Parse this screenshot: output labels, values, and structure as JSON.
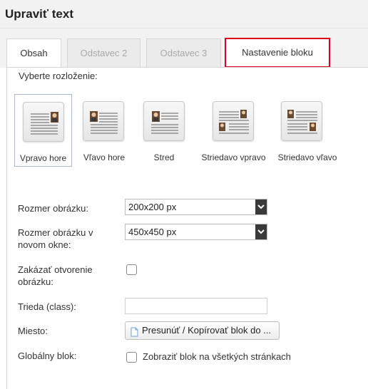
{
  "window": {
    "title": "Upraviť text"
  },
  "tabs": [
    {
      "label": "Obsah"
    },
    {
      "label": "Odstavec 2"
    },
    {
      "label": "Odstavec 3"
    },
    {
      "label": "Nastavenie bloku"
    }
  ],
  "layout": {
    "label": "Vyberte rozloženie:",
    "options": [
      {
        "label": "Vpravo hore",
        "icon": "image-right-top-icon"
      },
      {
        "label": "Vľavo hore",
        "icon": "image-left-top-icon"
      },
      {
        "label": "Stred",
        "icon": "image-center-icon"
      },
      {
        "label": "Striedavo vpravo",
        "icon": "image-alternate-right-icon"
      },
      {
        "label": "Striedavo vľavo",
        "icon": "image-alternate-left-icon"
      }
    ],
    "selected": "Vpravo hore"
  },
  "form": {
    "image_size": {
      "label": "Rozmer obrázku:",
      "value": "200x200 px"
    },
    "image_size_window": {
      "label": "Rozmer obrázku v novom okne:",
      "value": "450x450 px"
    },
    "disable_open": {
      "label": "Zakázať otvorenie obrázku:",
      "checked": false
    },
    "css_class": {
      "label": "Trieda (class):",
      "value": ""
    },
    "place": {
      "label": "Miesto:",
      "button": "Presunúť / Kopírovať blok do ..."
    },
    "global_block": {
      "label": "Globálny blok:",
      "checkbox_label": "Zobraziť blok na všetkých stránkach",
      "checked": false
    }
  },
  "colors": {
    "highlight": "#e0001a",
    "selected_border": "#aab8d6"
  }
}
